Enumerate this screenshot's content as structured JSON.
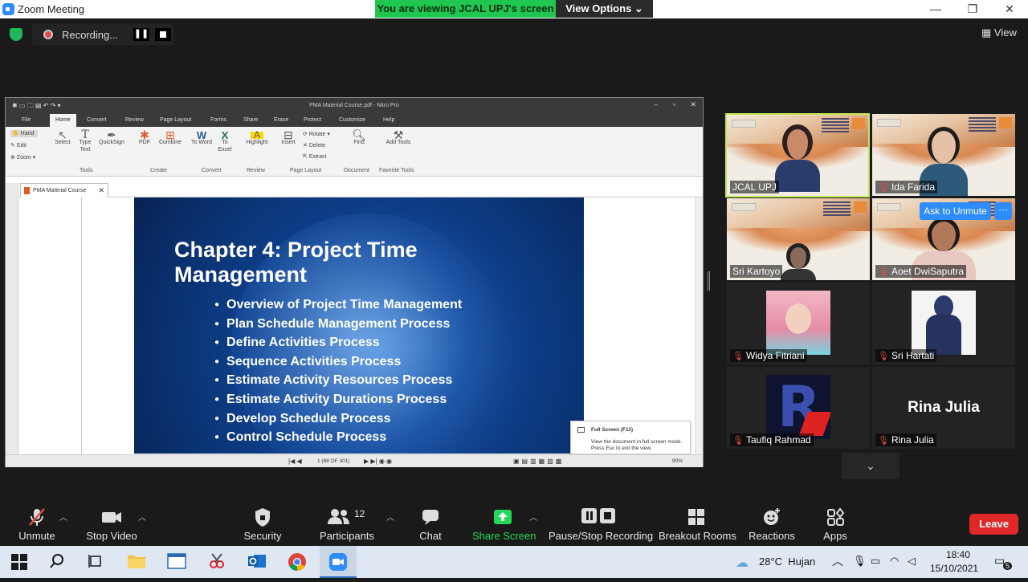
{
  "window": {
    "title": "Zoom Meeting",
    "minimize": "—",
    "restore": "❐",
    "close": "✕"
  },
  "banner": {
    "viewing": "You are viewing JCAL UPJ's screen",
    "view_options": "View Options ⌄"
  },
  "recording": {
    "label": "Recording...",
    "pause": "❚❚"
  },
  "view_button": "View",
  "nitro": {
    "title": "PMA Material Course.pdf - Nitro Pro",
    "menus": [
      "File",
      "Home",
      "Convert",
      "Review",
      "Page Layout",
      "Forms",
      "Share",
      "Erase",
      "Protect",
      "Customize",
      "Help"
    ],
    "left_tools": [
      "Hand",
      "Edit",
      "Zoom"
    ],
    "ribbon_buttons": [
      {
        "label": "Select",
        "icon": "select-icon"
      },
      {
        "label": "Type Text",
        "icon": "type-text-icon"
      },
      {
        "label": "QuickSign",
        "icon": "quicksign-icon"
      },
      {
        "label": "PDF",
        "icon": "pdf-icon"
      },
      {
        "label": "Combine",
        "icon": "combine-icon"
      },
      {
        "label": "To Word",
        "icon": "word-icon"
      },
      {
        "label": "To Excel",
        "icon": "excel-icon"
      },
      {
        "label": "Highlight",
        "icon": "highlight-icon"
      },
      {
        "label": "Insert",
        "icon": "insert-icon"
      },
      {
        "label": "Find",
        "icon": "find-icon"
      },
      {
        "label": "Add Tools",
        "icon": "add-tools-icon"
      }
    ],
    "page_layout_small": [
      "Rotate",
      "Delete",
      "Extract"
    ],
    "groups": [
      "Tools",
      "Create",
      "Convert",
      "Review",
      "Page Layout",
      "Document",
      "Favorite Tools"
    ],
    "tab": "PMA Material Course",
    "page_indicator": "1 (68 OF 301)",
    "zoom": "90%",
    "tooltip": {
      "title": "Full Screen (F11)",
      "body": "View the document in full screen mode. Press Esc to exit the view."
    }
  },
  "slide": {
    "title": "Chapter 4: Project Time Management",
    "bullets": [
      "Overview of Project Time Management",
      "Plan Schedule Management Process",
      "Define Activities Process",
      "Sequence Activities Process",
      "Estimate Activity Resources Process",
      "Estimate Activity Durations Process",
      "Develop Schedule Process",
      "Control Schedule Process"
    ]
  },
  "participants_gallery": [
    {
      "name": "JCAL UPJ",
      "muted": false,
      "active_speaker": true
    },
    {
      "name": "Ida Farida",
      "muted": true
    },
    {
      "name": "Sri Kartoyo",
      "muted": false
    },
    {
      "name": "Aoet DwiSaputra",
      "muted": true
    },
    {
      "name": "Widya Fitriani",
      "muted": true
    },
    {
      "name": "Sri Hartati",
      "muted": true
    },
    {
      "name": "Taufiq Rahmad",
      "muted": true
    },
    {
      "name": "Rina Julia",
      "muted": true,
      "avatar_text": "Rina Julia"
    }
  ],
  "ask_to_unmute": "Ask to Unmute",
  "more_dots": "···",
  "toolbar": {
    "unmute": "Unmute",
    "stop_video": "Stop Video",
    "security": "Security",
    "participants": "Participants",
    "participants_count": "12",
    "chat": "Chat",
    "share_screen": "Share Screen",
    "pause_stop_recording": "Pause/Stop Recording",
    "breakout_rooms": "Breakout Rooms",
    "reactions": "Reactions",
    "apps": "Apps",
    "leave": "Leave"
  },
  "taskbar": {
    "weather": "28°C  Hujan",
    "time": "18:40",
    "date": "15/10/2021",
    "notifications": "5"
  },
  "colors": {
    "zoom_blue": "#2d8cff",
    "share_green": "#23d959",
    "leave_red": "#e02828",
    "active_speaker": "#c4e85a"
  }
}
